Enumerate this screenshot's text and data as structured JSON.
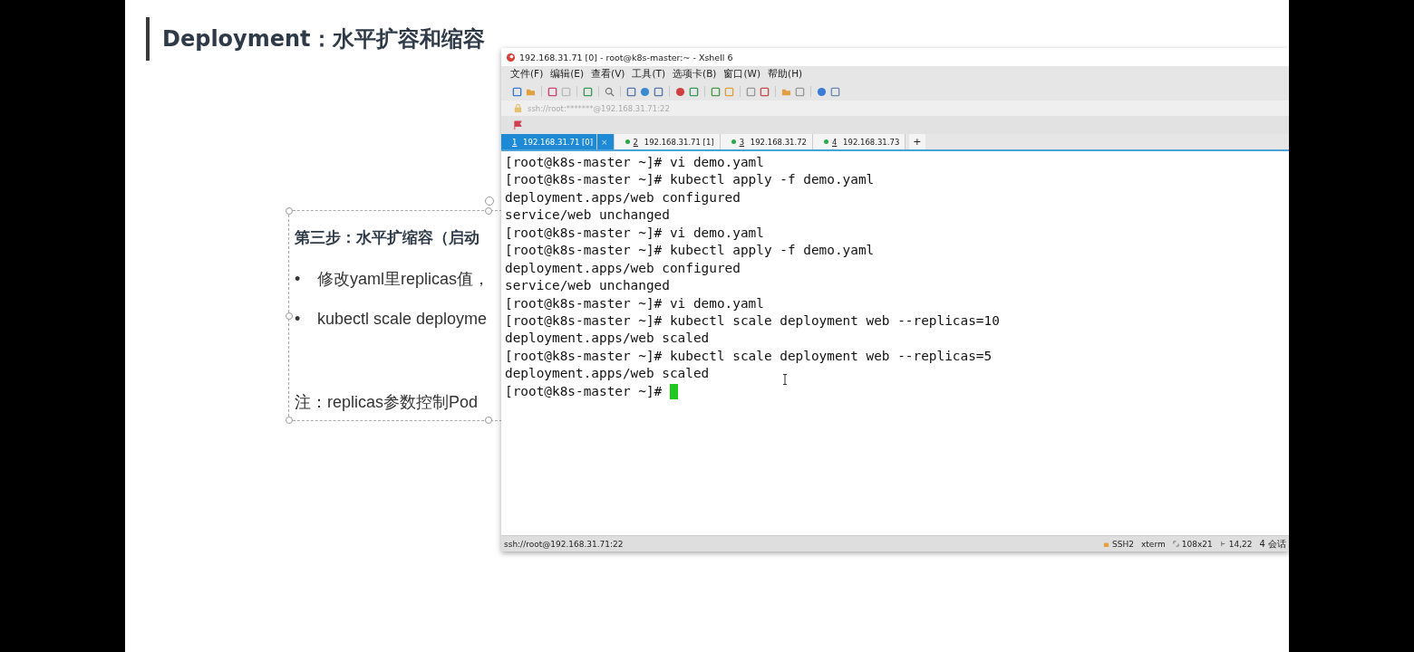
{
  "slide": {
    "title": "Deployment：水平扩容和缩容",
    "text_box": {
      "selected": true,
      "heading": "第三步：水平扩缩容（启动",
      "bullets": [
        {
          "marker": "•",
          "text": "修改yaml里replicas值，"
        },
        {
          "marker": "•",
          "text": "kubectl scale deployme"
        }
      ],
      "note": "注：replicas参数控制Pod"
    }
  },
  "window": {
    "title": "192.168.31.71 [0] - root@k8s-master:~ - Xshell 6",
    "menu": [
      "文件(F)",
      "编辑(E)",
      "查看(V)",
      "工具(T)",
      "选项卡(B)",
      "窗口(W)",
      "帮助(H)"
    ],
    "address": "ssh://root:*******@192.168.31.71:22",
    "tabs": [
      {
        "number": "1",
        "label": "192.168.31.71 [0]",
        "selected": true,
        "close": "×"
      },
      {
        "number": "2",
        "label": "192.168.31.71 [1]",
        "selected": false
      },
      {
        "number": "3",
        "label": "192.168.31.72",
        "selected": false
      },
      {
        "number": "4",
        "label": "192.168.31.73",
        "selected": false
      }
    ],
    "new_tab": "+",
    "terminal": [
      "[root@k8s-master ~]# vi demo.yaml",
      "[root@k8s-master ~]# kubectl apply -f demo.yaml",
      "deployment.apps/web configured",
      "service/web unchanged",
      "[root@k8s-master ~]# vi demo.yaml",
      "[root@k8s-master ~]# kubectl apply -f demo.yaml",
      "deployment.apps/web configured",
      "service/web unchanged",
      "[root@k8s-master ~]# vi demo.yaml",
      "[root@k8s-master ~]# kubectl scale deployment web --replicas=10",
      "deployment.apps/web scaled",
      "[root@k8s-master ~]# kubectl scale deployment web --replicas=5",
      "deployment.apps/web scaled",
      "[root@k8s-master ~]# "
    ],
    "status_bar": {
      "connection": "ssh://root@192.168.31.71:22",
      "protocol": "SSH2",
      "terminal_type": "xterm",
      "size": "108x21",
      "cursor": "14,22",
      "sessions": "4 会话"
    }
  }
}
